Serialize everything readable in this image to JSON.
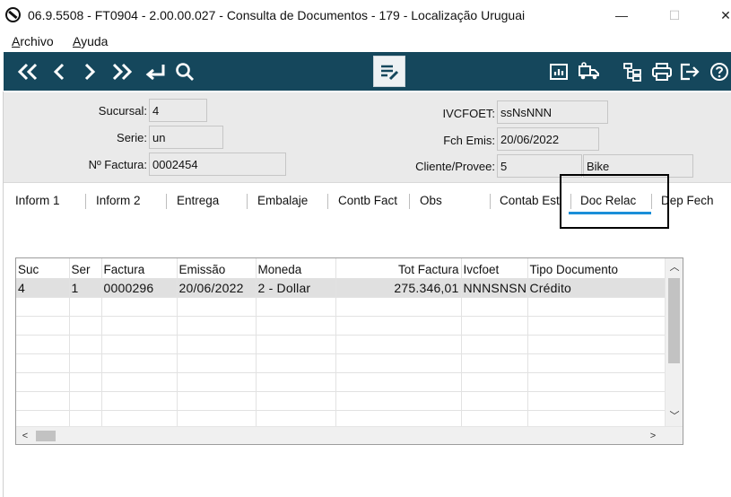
{
  "window": {
    "title": "06.9.5508 - FT0904 - 2.00.00.027 - Consulta de Documentos - 179 - Localização Uruguai",
    "minimize": "—",
    "maximize": "☐",
    "close": "✕"
  },
  "menu": {
    "archivo_first": "A",
    "archivo_rest": "rchivo",
    "ayuda_first": "A",
    "ayuda_rest": "yuda"
  },
  "toolbar": {
    "left_icons": [
      "first-page-icon",
      "previous-icon",
      "next-icon",
      "last-page-icon",
      "return-icon",
      "search-icon"
    ],
    "center_icon": "edit-list-icon",
    "right_icons": [
      "report-chart-icon",
      "delivery-truck-icon",
      "tree-structure-icon",
      "print-icon",
      "exit-icon",
      "help-icon"
    ],
    "colors": {
      "background": "#15475c",
      "icon": "#ffffff"
    }
  },
  "form": {
    "sucursal_label": "Sucursal:",
    "sucursal_value": "4",
    "serie_label": "Serie:",
    "serie_value": "un",
    "factura_label": "Nº Factura:",
    "factura_value": "0002454",
    "ivcfoet_label": "IVCFOET:",
    "ivcfoet_value": "ssNsNNN",
    "fch_emis_label": "Fch Emis:",
    "fch_emis_value": "20/06/2022",
    "cliente_label": "Cliente/Provee:",
    "cliente_code": "5",
    "cliente_name": "Bike"
  },
  "tabs": {
    "items": [
      "Inform 1",
      "Inform 2",
      "Entrega",
      "Embalaje",
      "Contb Fact",
      "Obs",
      "Contab Est",
      "Doc Relac",
      "Dep Fech"
    ],
    "active": "Doc Relac",
    "active_color": "#1a8ed8"
  },
  "table": {
    "headers": [
      "Suc",
      "Ser",
      "Factura",
      "Emissão",
      "Moneda",
      "Tot Factura",
      "Ivcfoet",
      "Tipo Documento"
    ],
    "rows": [
      [
        "4",
        "1",
        "0000296",
        "20/06/2022",
        "2 - Dollar",
        "275.346,01",
        "NNNSNSN",
        "Crédito"
      ]
    ],
    "empty_rows": 7,
    "scroll_up": "︿",
    "scroll_down": "﹀",
    "scroll_left": "<",
    "scroll_right": ">"
  }
}
